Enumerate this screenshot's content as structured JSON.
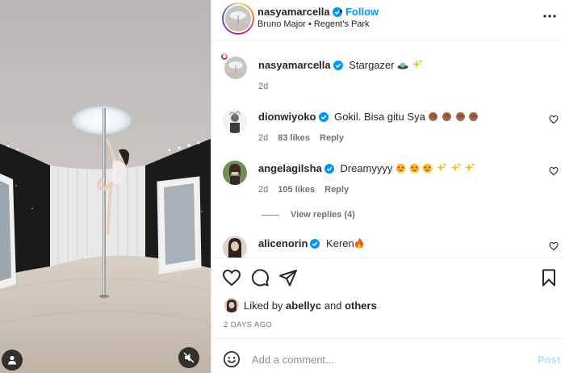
{
  "post": {
    "author": "nasyamarcella",
    "follow_label": "Follow",
    "location": "Bruno Major • Regent's Park",
    "caption": "Stargazer",
    "caption_age": "2d",
    "dot": "•"
  },
  "comments": [
    {
      "user": "dionwiyoko",
      "text": "Gokil. Bisa gitu Sya",
      "age": "2d",
      "likes": "83 likes",
      "reply": "Reply"
    },
    {
      "user": "angelagilsha",
      "text": "Dreamyyyy",
      "age": "2d",
      "likes": "105 likes",
      "reply": "Reply"
    },
    {
      "user": "alicenorin",
      "text": "Keren"
    }
  ],
  "view_replies": "View replies (4)",
  "liked_by": {
    "prefix": "Liked by",
    "user": "abellyc",
    "and": "and",
    "others": "others"
  },
  "timestamp": "2 DAYS AGO",
  "composer": {
    "placeholder": "Add a comment...",
    "post_label": "Post"
  },
  "colors": {
    "accent": "#0095f6",
    "verified": "#0095f6",
    "post_disabled": "#b2dffc"
  }
}
